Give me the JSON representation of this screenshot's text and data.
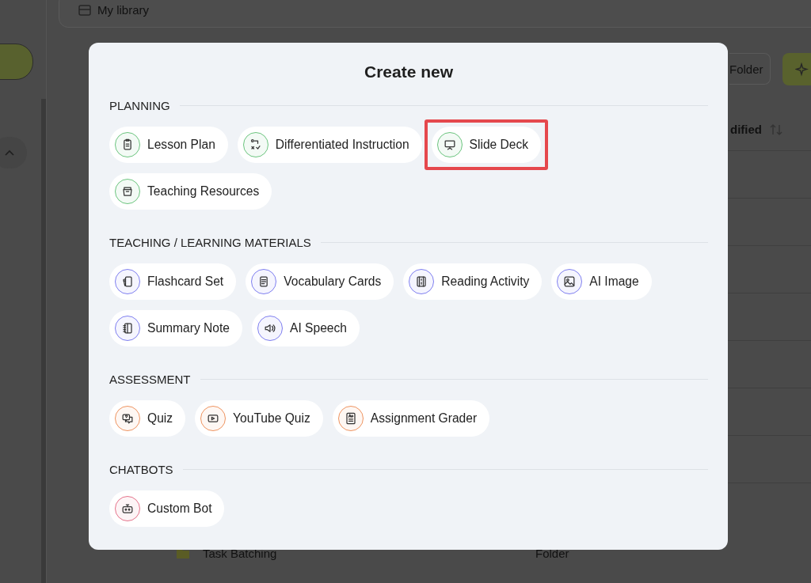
{
  "background": {
    "header": {
      "title": "My library"
    },
    "toolbar": {
      "folder_button": "Folder"
    },
    "table": {
      "sort_column": "dified",
      "rows": [
        {
          "name": "Task Batching",
          "type": "Folder"
        }
      ]
    }
  },
  "dialog": {
    "title": "Create new",
    "sections": [
      {
        "title": "PLANNING",
        "color": "#6cc57f",
        "items": [
          {
            "label": "Lesson Plan",
            "highlighted": false
          },
          {
            "label": "Differentiated Instruction",
            "highlighted": false
          },
          {
            "label": "Slide Deck",
            "highlighted": true
          },
          {
            "label": "Teaching Resources",
            "highlighted": false
          }
        ]
      },
      {
        "title": "TEACHING / LEARNING MATERIALS",
        "color": "#7f7ff0",
        "items": [
          {
            "label": "Flashcard Set",
            "highlighted": false
          },
          {
            "label": "Vocabulary Cards",
            "highlighted": false
          },
          {
            "label": "Reading Activity",
            "highlighted": false
          },
          {
            "label": "AI Image",
            "highlighted": false
          },
          {
            "label": "Summary Note",
            "highlighted": false
          },
          {
            "label": "AI Speech",
            "highlighted": false
          }
        ]
      },
      {
        "title": "ASSESSMENT",
        "color": "#ef9460",
        "items": [
          {
            "label": "Quiz",
            "highlighted": false
          },
          {
            "label": "YouTube Quiz",
            "highlighted": false
          },
          {
            "label": "Assignment Grader",
            "highlighted": false
          }
        ]
      },
      {
        "title": "CHATBOTS",
        "color": "#e6738b",
        "items": [
          {
            "label": "Custom Bot",
            "highlighted": false
          }
        ]
      }
    ]
  }
}
